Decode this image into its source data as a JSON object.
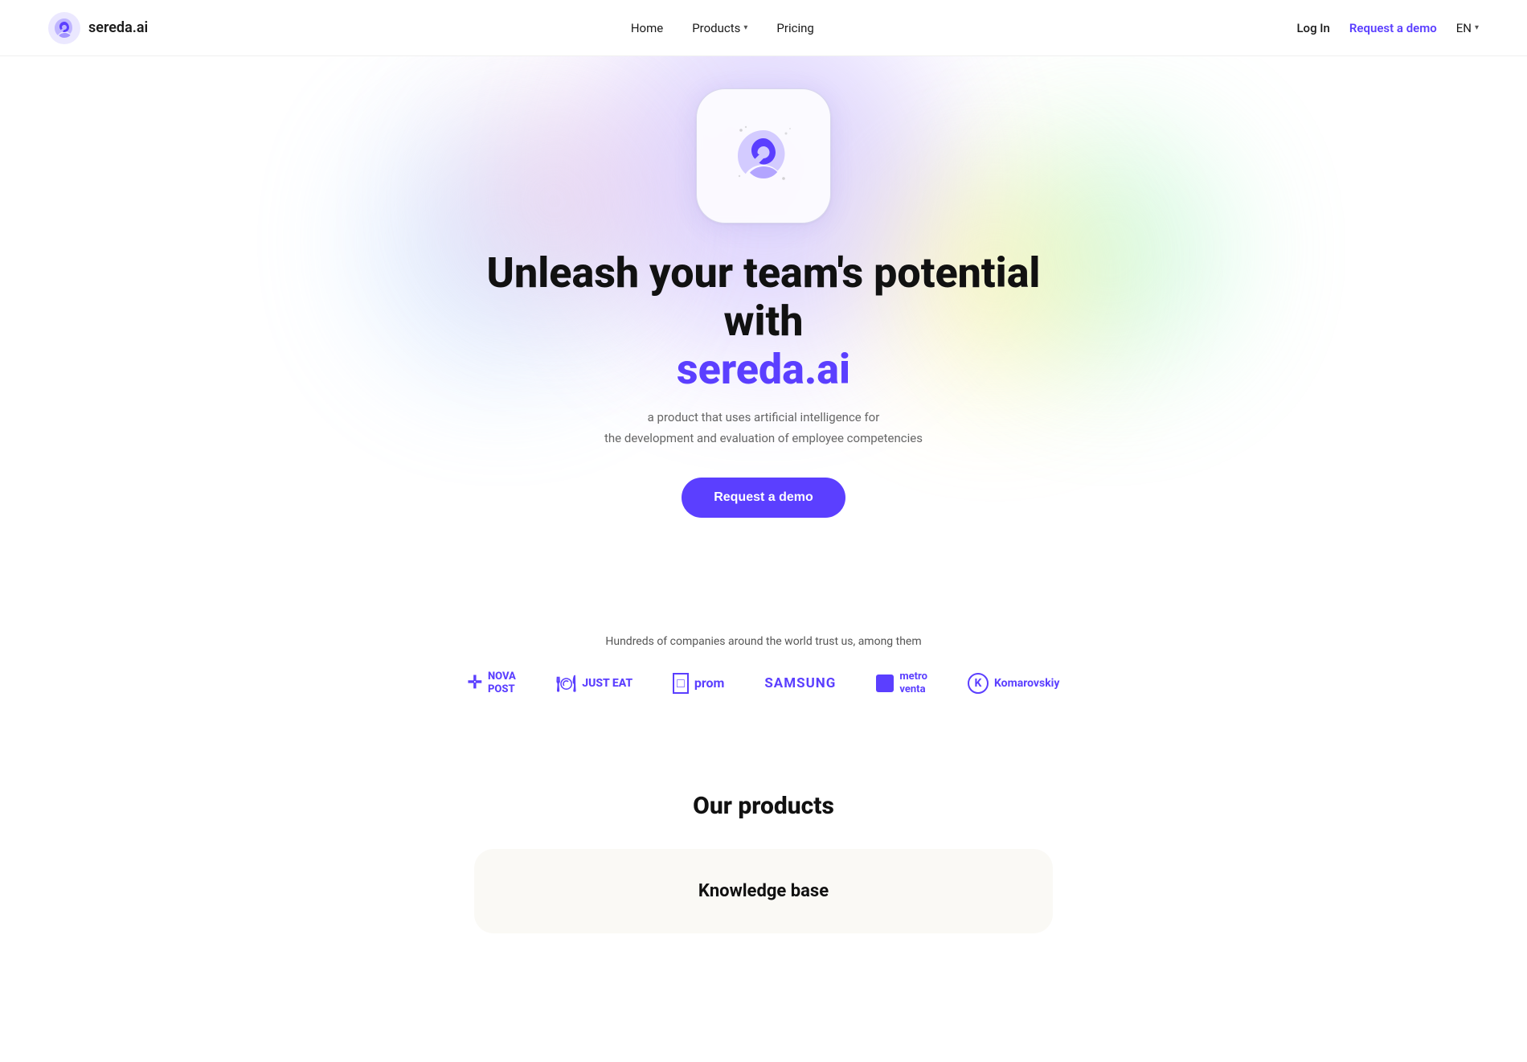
{
  "navbar": {
    "logo_text": "sereda.ai",
    "nav_links": [
      {
        "id": "home",
        "label": "Home",
        "has_dropdown": false
      },
      {
        "id": "products",
        "label": "Products",
        "has_dropdown": true
      },
      {
        "id": "pricing",
        "label": "Pricing",
        "has_dropdown": false
      }
    ],
    "login_label": "Log In",
    "request_demo_label": "Request a demo",
    "language": "EN"
  },
  "hero": {
    "headline_part1": "Unleash your team's potential with",
    "headline_brand": "sereda.ai",
    "subtitle_line1": "a product that uses artificial intelligence for",
    "subtitle_line2": "the development and evaluation of employee competencies",
    "cta_label": "Request a demo"
  },
  "trust": {
    "text": "Hundreds of companies around the world trust us, among them",
    "logos": [
      {
        "id": "nova-post",
        "icon": "⊕",
        "text": "NOVA\nPOST"
      },
      {
        "id": "just-eat",
        "icon": "🍽",
        "text": "JUST EAT"
      },
      {
        "id": "prom",
        "icon": "☐",
        "text": "prom"
      },
      {
        "id": "samsung",
        "icon": "",
        "text": "SAMSUNG"
      },
      {
        "id": "metro-venta",
        "icon": "▪",
        "text": "metro venta"
      },
      {
        "id": "komarovskiy",
        "icon": "✦",
        "text": "Komarovskiy"
      }
    ]
  },
  "products": {
    "section_title": "Our products",
    "cards": [
      {
        "id": "knowledge-base",
        "title": "Knowledge base"
      }
    ]
  },
  "colors": {
    "brand_purple": "#5b3fff",
    "text_dark": "#111111",
    "text_gray": "#666666"
  }
}
